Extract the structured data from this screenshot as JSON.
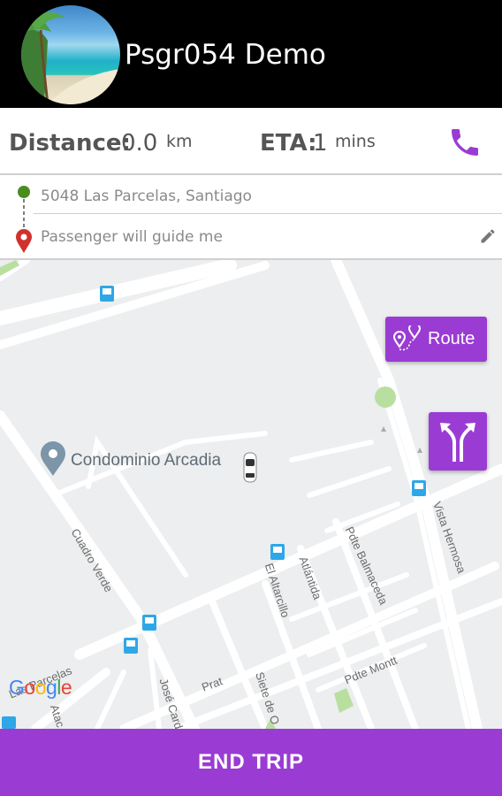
{
  "header": {
    "driver_name": "Psgr054 Demo",
    "avatar_icon": "avatar-beach-photo"
  },
  "stats": {
    "distance_label": "Distance:",
    "distance_value": "0.0",
    "distance_unit": "km",
    "eta_label": "ETA:",
    "eta_value": "1",
    "eta_unit": "mins",
    "call_icon": "phone-icon"
  },
  "address": {
    "pickup": "5048 Las Parcelas, Santiago",
    "dropoff": "Passenger will guide me",
    "pickup_icon": "green-dot-pin-icon",
    "dropoff_icon": "red-location-pin-icon",
    "edit_icon": "pencil-icon"
  },
  "map": {
    "poi_label": "Condominio Arcadia",
    "streets": [
      "Vista Hermosa",
      "Pdte Balmaceda",
      "Atlántida",
      "El Altarcillo",
      "Cuadro Verde",
      "Pdte Montt",
      "José Card",
      "Siete de O",
      "Prat",
      "Las Parcelas",
      "Atac"
    ],
    "provider_logo": "Google",
    "route_button": "Route",
    "route_icon": "route-pins-icon",
    "navigate_icon": "split-arrows-icon"
  },
  "footer": {
    "end_trip": "END TRIP"
  },
  "colors": {
    "accent": "#9a3cd3",
    "header": "#000000",
    "pickup": "#4c8c1f",
    "dropoff": "#d0312d"
  }
}
